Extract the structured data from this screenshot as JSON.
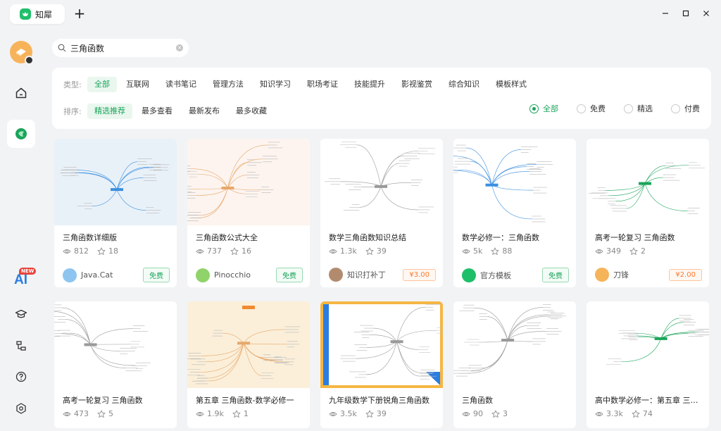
{
  "tab": {
    "title": "知犀"
  },
  "search": {
    "value": "三角函数"
  },
  "filters": {
    "type_label": "类型:",
    "types": [
      "全部",
      "互联网",
      "读书笔记",
      "管理方法",
      "知识学习",
      "职场考证",
      "技能提升",
      "影视鉴赏",
      "综合知识",
      "模板样式"
    ],
    "active_type": "全部",
    "sort_label": "排序:",
    "sorts": [
      "精选推荐",
      "最多查看",
      "最新发布",
      "最多收藏"
    ],
    "active_sort": "精选推荐",
    "prices": [
      "全部",
      "免费",
      "精选",
      "付费"
    ],
    "active_price": "全部"
  },
  "sidebar": {
    "ai_badge": "NEW",
    "ai_label": "AI"
  },
  "colors": {
    "accent": "#1aa45a",
    "paid": "#ff7a2f",
    "ai": "#2a7de1"
  },
  "cards": [
    {
      "title": "三角函数详细版",
      "views": "812",
      "stars": "18",
      "author": "Java.Cat",
      "price": "免费",
      "paid": false,
      "bg": "#e9f1f8"
    },
    {
      "title": "三角函数公式大全",
      "views": "737",
      "stars": "16",
      "author": "Pinocchio",
      "price": "免费",
      "paid": false,
      "bg": "#fdf4ef"
    },
    {
      "title": "数学三角函数知识总结",
      "views": "1.3k",
      "stars": "39",
      "author": "知识打补丁",
      "price": "¥3.00",
      "paid": true,
      "bg": "#ffffff"
    },
    {
      "title": "数学必修一：三角函数",
      "views": "5k",
      "stars": "88",
      "author": "官方模板",
      "price": "免费",
      "paid": false,
      "bg": "#ffffff"
    },
    {
      "title": "高考一轮复习 三角函数",
      "views": "349",
      "stars": "2",
      "author": "刀锋",
      "price": "¥2.00",
      "paid": true,
      "bg": "#ffffff"
    },
    {
      "title": "高考一轮复习 三角函数",
      "views": "473",
      "stars": "5",
      "author": "",
      "price": "",
      "paid": false,
      "bg": "#ffffff"
    },
    {
      "title": "第五章 三角函数-数学必修一",
      "views": "1.9k",
      "stars": "1",
      "author": "",
      "price": "",
      "paid": false,
      "bg": "#fbefd9"
    },
    {
      "title": "九年级数学下册锐角三角函数",
      "views": "3.5k",
      "stars": "39",
      "author": "",
      "price": "",
      "paid": false,
      "bg": "#f5b642"
    },
    {
      "title": "三角函数",
      "views": "90",
      "stars": "3",
      "author": "",
      "price": "",
      "paid": false,
      "bg": "#ffffff"
    },
    {
      "title": "高中数学必修一：第五章 三角函数",
      "views": "3.3k",
      "stars": "74",
      "author": "",
      "price": "",
      "paid": false,
      "bg": "#ffffff"
    }
  ]
}
